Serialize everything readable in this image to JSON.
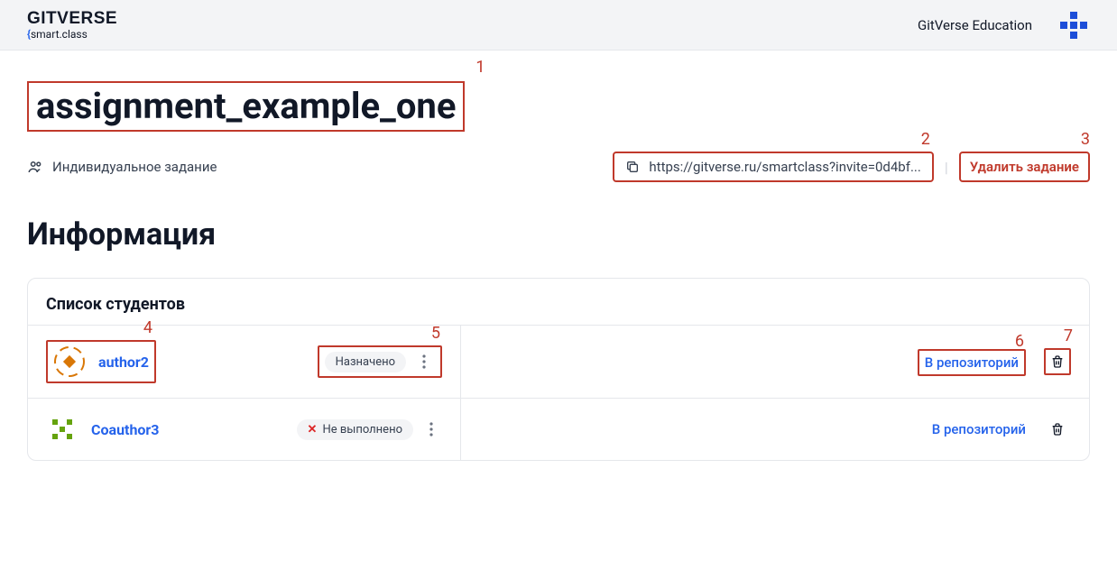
{
  "header": {
    "logo_main": "GITVERSE",
    "logo_sub_pre": "{",
    "logo_sub_text": "smart.class",
    "edu_label": "GitVerse Education"
  },
  "page": {
    "title": "assignment_example_one",
    "subtitle": "Индивидуальное задание",
    "invite_url": "https://gitverse.ru/smartclass?invite=0d4bf...",
    "delete_label": "Удалить задание",
    "info_heading": "Информация",
    "students_heading": "Список студентов",
    "repo_link_label": "В репозиторий"
  },
  "annotations": {
    "n1": "1",
    "n2": "2",
    "n3": "3",
    "n4": "4",
    "n5": "5",
    "n6": "6",
    "n7": "7"
  },
  "students": [
    {
      "name": "author2",
      "status": "Назначено",
      "status_type": "assigned"
    },
    {
      "name": "Coauthor3",
      "status": "Не выполнено",
      "status_type": "failed"
    }
  ]
}
